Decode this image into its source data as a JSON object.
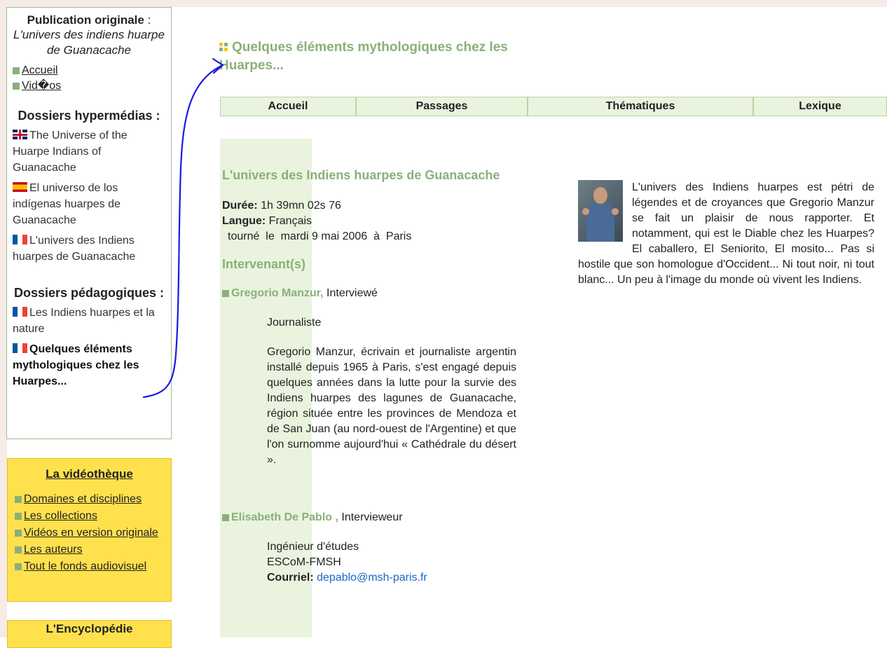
{
  "left_panel": {
    "pub_title": "Publication originale",
    "pub_subtitle": "L'univers des indiens huarpe de Guanacache",
    "nav": [
      {
        "label": "Accueil"
      },
      {
        "label": "Vid�os"
      }
    ],
    "hypermedia_heading": "Dossiers hypermédias :",
    "hypermedia_items": [
      {
        "label": "The Universe of the Huarpe Indians of Guanacache",
        "flag": "uk-flag"
      },
      {
        "label": "El universo de los indígenas huarpes de Guanacache",
        "flag": "spain-flag"
      },
      {
        "label": "L'univers des Indiens huarpes de Guanacache",
        "flag": "france-flag"
      }
    ],
    "pedagogic_heading": "Dossiers pédagogiques :",
    "pedagogic_items": [
      {
        "label": "Les Indiens huarpes et la nature",
        "flag": "france-flag"
      },
      {
        "label": "Quelques éléments mythologiques chez les Huarpes...",
        "flag": "france-flag"
      }
    ]
  },
  "videotheque": {
    "title": "La vidéothèque",
    "items": [
      "Domaines et disciplines",
      "Les collections",
      "Vidéos en version originale",
      "Les auteurs",
      "Tout le fonds audiovisuel"
    ]
  },
  "encyclopedie": {
    "title": "L'Encyclopédie"
  },
  "main": {
    "title": "Quelques éléments mythologiques chez les Huarpes...",
    "tabs": [
      "Accueil",
      "Passages",
      "Thématiques",
      "Lexique"
    ],
    "video_title": "L'univers des Indiens huarpes de Guanacache",
    "duration_label": "Durée:",
    "duration_value": "1h 39mn 02s 76",
    "language_label": "Langue:",
    "language_value": "Français",
    "shot_text": "tourné  le  mardi 9 mai 2006  à  Paris",
    "speakers_heading": "Intervenant(s)",
    "speakers": [
      {
        "name": "Gregorio Manzur,",
        "role": "Interviewé",
        "job": "Journaliste",
        "bio": "Gregorio Manzur, écrivain et journaliste argentin installé depuis 1965 à Paris, s'est engagé depuis quelques années dans la lutte pour la survie des Indiens huarpes des lagunes de Guanacache, région située entre les provinces de Mendoza et de San Juan (au nord-ouest de l'Argentine) et que l'on surnomme aujourd'hui « Cathédrale du désert »."
      },
      {
        "name": "Elisabeth De Pablo ,",
        "role": "Intervieweur",
        "job_line1": "Ingénieur d'études",
        "job_line2": "ESCoM-FMSH",
        "email_label": "Courriel:",
        "email": "depablo@msh-paris.fr"
      }
    ]
  },
  "summary": "L'univers des Indiens huarpes est pétri de légendes et de croyances que Gregorio Manzur se fait un plaisir de nous rapporter. Et notamment, qui est le Diable chez les Huarpes? El caballero, El Seniorito, El mosito... Pas si hostile que son homologue d'Occident... Ni tout noir, ni tout blanc... Un peu à l'image du monde où vivent les Indiens.",
  "colors": {
    "accent_green": "#8ab07a",
    "tab_bg": "#eaf3de",
    "yellow_box": "#ffe14d",
    "annotation_blue": "#1a1ae0"
  }
}
